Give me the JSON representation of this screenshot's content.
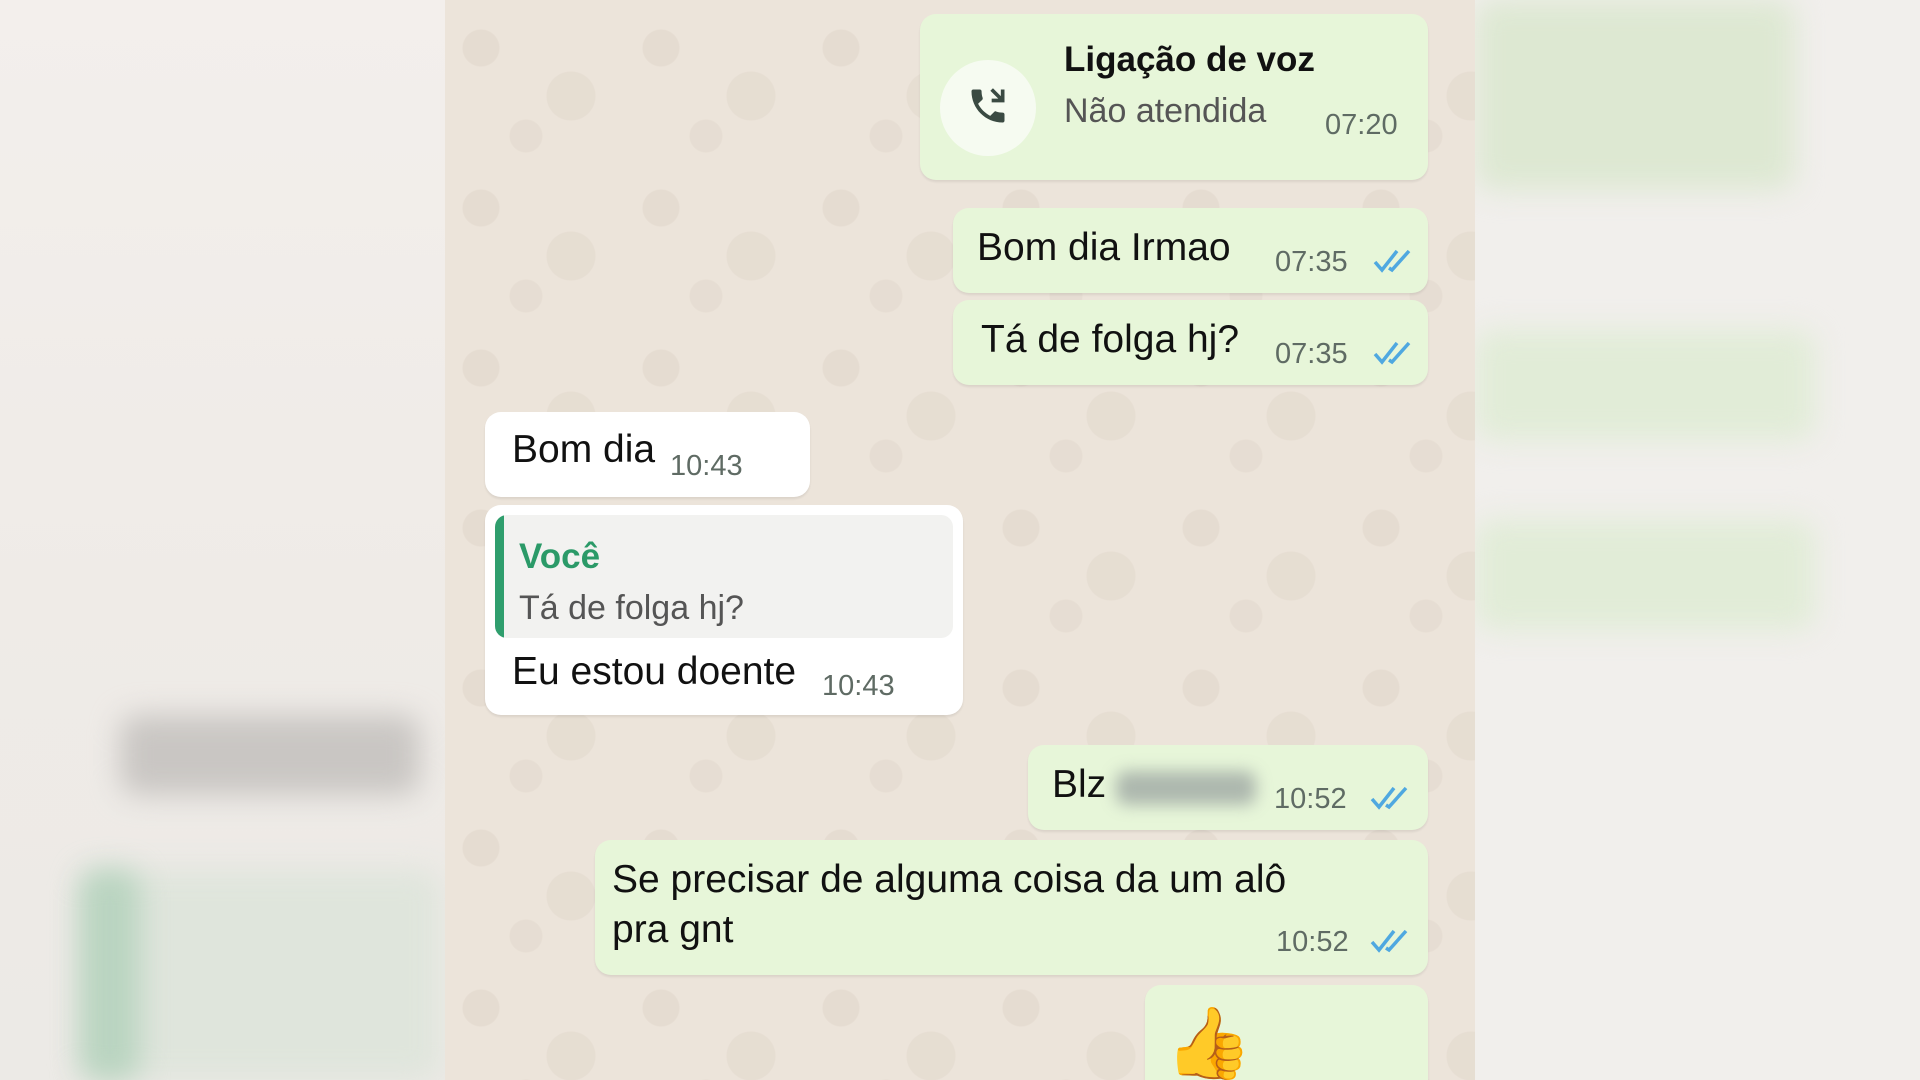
{
  "chat": {
    "call": {
      "title": "Ligação de voz",
      "status": "Não atendida",
      "time": "07:20",
      "icon": "missed-call-icon"
    },
    "messages": [
      {
        "text": "Bom dia Irmao",
        "time": "07:35",
        "direction": "outgoing",
        "read": true
      },
      {
        "text": "Tá de folga hj?",
        "time": "07:35",
        "direction": "outgoing",
        "read": true
      },
      {
        "text": "Bom dia",
        "time": "10:43",
        "direction": "incoming"
      },
      {
        "text": "Eu estou doente",
        "time": "10:43",
        "direction": "incoming",
        "quote": {
          "author": "Você",
          "text": "Tá de folga hj?"
        }
      },
      {
        "text": "Blz",
        "time": "10:52",
        "direction": "outgoing",
        "read": true
      },
      {
        "line1": "Se precisar de alguma coisa da um alô",
        "line2": "pra gnt",
        "time": "10:52",
        "direction": "outgoing",
        "read": true
      },
      {
        "text": "👍",
        "direction": "outgoing"
      }
    ]
  },
  "colors": {
    "outgoing_bubble": "#e7f6d9",
    "incoming_bubble": "#ffffff",
    "read_ticks": "#4fa8e0",
    "quote_accent": "#2f9e6d"
  }
}
